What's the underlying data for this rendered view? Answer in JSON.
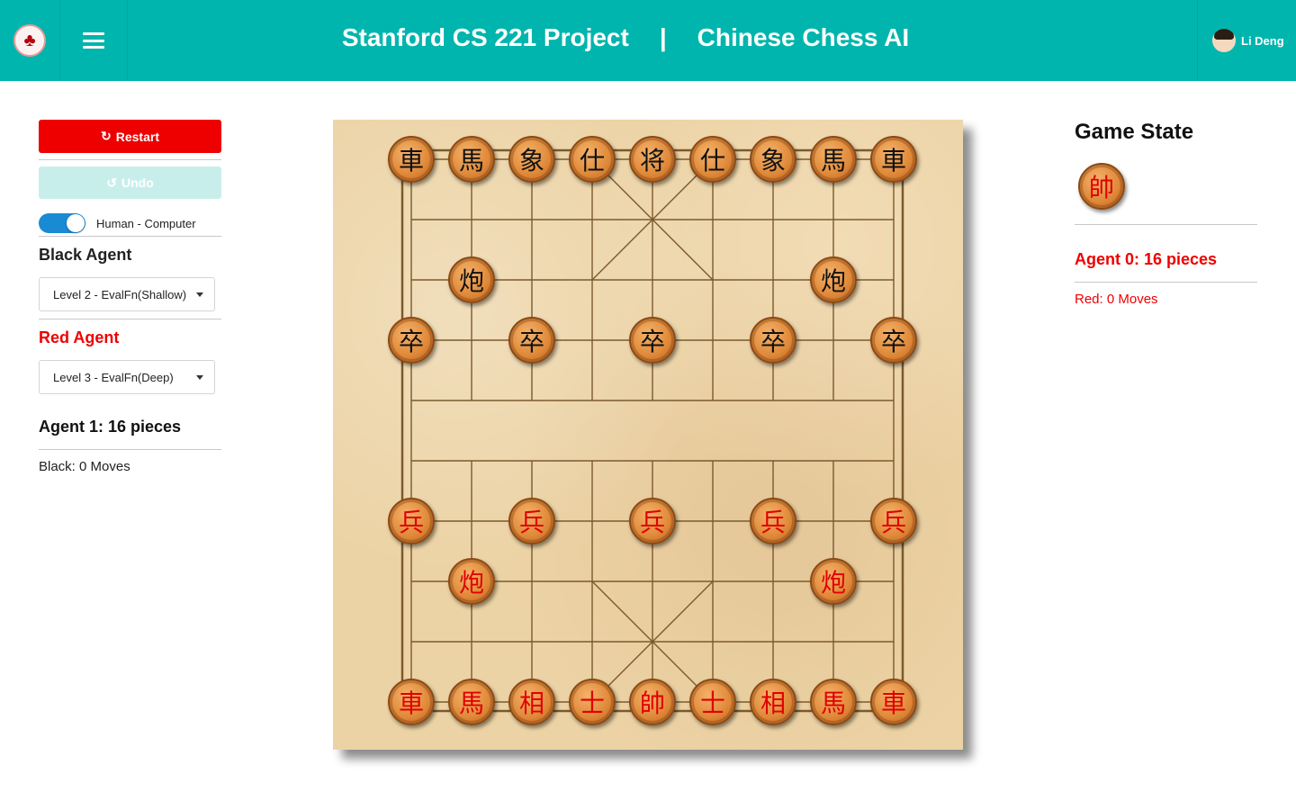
{
  "header": {
    "logo_icon": "stanford-tree-logo",
    "menu_icon": "hamburger-icon",
    "title_left": "Stanford CS 221 Project",
    "separator": "|",
    "title_right": "Chinese Chess AI",
    "user_name": "Li Deng"
  },
  "controls": {
    "restart_label": "Restart",
    "restart_icon": "↻",
    "undo_label": "Undo",
    "undo_icon": "↺",
    "mode_label": "Human - Computer",
    "mode_on": true,
    "black_agent_title": "Black Agent",
    "black_agent_selected": "Level 2 - EvalFn(Shallow)",
    "red_agent_title": "Red Agent",
    "red_agent_selected": "Level 3 - EvalFn(Deep)",
    "agent1_pieces": "Agent 1: 16 pieces",
    "black_moves": "Black: 0 Moves"
  },
  "game_state": {
    "title": "Game State",
    "turn_piece": "帥",
    "agent0_pieces": "Agent 0: 16 pieces",
    "red_moves": "Red: 0 Moves"
  },
  "board": {
    "files": 9,
    "ranks": 10,
    "pieces": [
      {
        "char": "車",
        "side": "black",
        "col": 0,
        "row": 0
      },
      {
        "char": "馬",
        "side": "black",
        "col": 1,
        "row": 0
      },
      {
        "char": "象",
        "side": "black",
        "col": 2,
        "row": 0
      },
      {
        "char": "仕",
        "side": "black",
        "col": 3,
        "row": 0
      },
      {
        "char": "将",
        "side": "black",
        "col": 4,
        "row": 0
      },
      {
        "char": "仕",
        "side": "black",
        "col": 5,
        "row": 0
      },
      {
        "char": "象",
        "side": "black",
        "col": 6,
        "row": 0
      },
      {
        "char": "馬",
        "side": "black",
        "col": 7,
        "row": 0
      },
      {
        "char": "車",
        "side": "black",
        "col": 8,
        "row": 0
      },
      {
        "char": "炮",
        "side": "black",
        "col": 1,
        "row": 2
      },
      {
        "char": "炮",
        "side": "black",
        "col": 7,
        "row": 2
      },
      {
        "char": "卒",
        "side": "black",
        "col": 0,
        "row": 3
      },
      {
        "char": "卒",
        "side": "black",
        "col": 2,
        "row": 3
      },
      {
        "char": "卒",
        "side": "black",
        "col": 4,
        "row": 3
      },
      {
        "char": "卒",
        "side": "black",
        "col": 6,
        "row": 3
      },
      {
        "char": "卒",
        "side": "black",
        "col": 8,
        "row": 3
      },
      {
        "char": "兵",
        "side": "red",
        "col": 0,
        "row": 6
      },
      {
        "char": "兵",
        "side": "red",
        "col": 2,
        "row": 6
      },
      {
        "char": "兵",
        "side": "red",
        "col": 4,
        "row": 6
      },
      {
        "char": "兵",
        "side": "red",
        "col": 6,
        "row": 6
      },
      {
        "char": "兵",
        "side": "red",
        "col": 8,
        "row": 6
      },
      {
        "char": "炮",
        "side": "red",
        "col": 1,
        "row": 7
      },
      {
        "char": "炮",
        "side": "red",
        "col": 7,
        "row": 7
      },
      {
        "char": "車",
        "side": "red",
        "col": 0,
        "row": 9
      },
      {
        "char": "馬",
        "side": "red",
        "col": 1,
        "row": 9
      },
      {
        "char": "相",
        "side": "red",
        "col": 2,
        "row": 9
      },
      {
        "char": "士",
        "side": "red",
        "col": 3,
        "row": 9
      },
      {
        "char": "帥",
        "side": "red",
        "col": 4,
        "row": 9
      },
      {
        "char": "士",
        "side": "red",
        "col": 5,
        "row": 9
      },
      {
        "char": "相",
        "side": "red",
        "col": 6,
        "row": 9
      },
      {
        "char": "馬",
        "side": "red",
        "col": 7,
        "row": 9
      },
      {
        "char": "車",
        "side": "red",
        "col": 8,
        "row": 9
      }
    ]
  }
}
